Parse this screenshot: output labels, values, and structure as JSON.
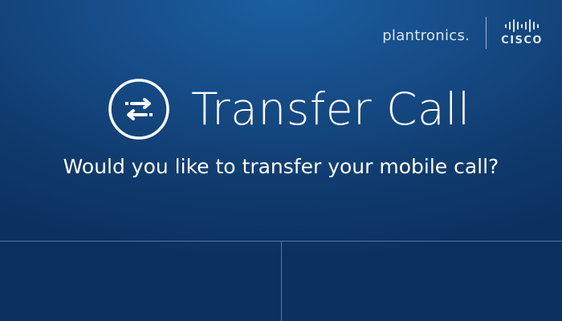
{
  "brand": {
    "partner_name": "plantronics.",
    "logo_icon": "cisco-logo",
    "logo_text": "CISCO"
  },
  "dialog": {
    "icon": "transfer-arrows-icon",
    "title": "Transfer Call",
    "question": "Would you like to transfer your mobile call?"
  },
  "buttons": {
    "left_label": "",
    "right_label": ""
  },
  "colors": {
    "background_top": "#1b5fa0",
    "background_bottom": "#0c3161",
    "text": "#ffffff",
    "divider": "#9fb4cf"
  }
}
